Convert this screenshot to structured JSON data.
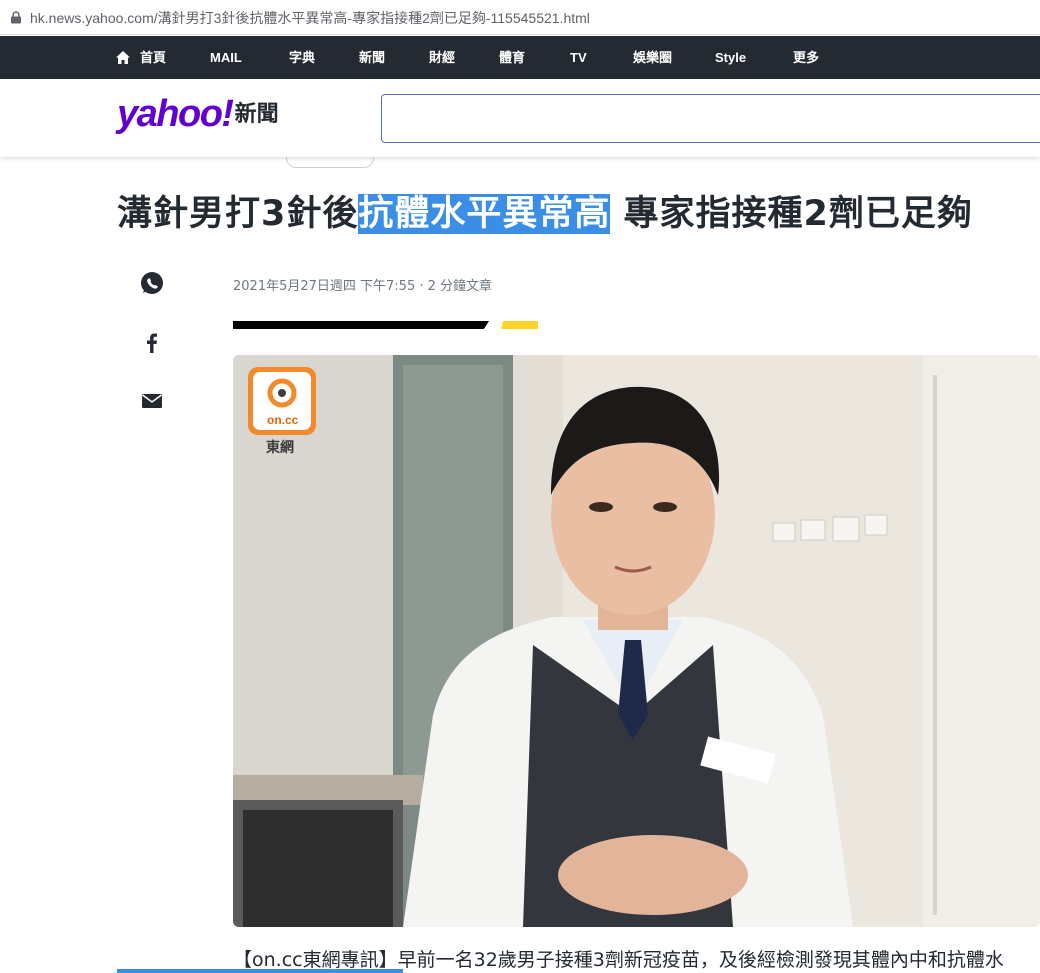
{
  "browser": {
    "url": "hk.news.yahoo.com/溝針男打3針後抗體水平異常高-專家指接種2劑已足夠-115545521.html"
  },
  "nav": {
    "items": [
      {
        "label": "首頁"
      },
      {
        "label": "MAIL"
      },
      {
        "label": "字典"
      },
      {
        "label": "新聞"
      },
      {
        "label": "財經"
      },
      {
        "label": "體育"
      },
      {
        "label": "TV"
      },
      {
        "label": "娛樂圈"
      },
      {
        "label": "Style"
      },
      {
        "label": "更多"
      }
    ]
  },
  "header": {
    "logo_text": "yahoo!",
    "section": "新聞",
    "search_placeholder": ""
  },
  "article": {
    "headline_pre": "溝針男打3針後",
    "headline_highlight": "抗體水平異常高",
    "headline_post": " 專家指接種2劑已足夠",
    "meta": "2021年5月27日週四 下午7:55 · 2 分鐘文章",
    "photo_badge": "on.cc",
    "photo_badge_sub": "東網",
    "lead": "【on.cc東網專訊】早前一名32歲男子接種3劑新冠疫苗，及後經檢測發現其體內中和抗體水",
    "read_progress": 0.31
  },
  "colors": {
    "brand": "#6001d2",
    "nav_bg": "#232a31",
    "highlight": "#3a8ee6",
    "accent_yellow": "#ffd42a"
  }
}
